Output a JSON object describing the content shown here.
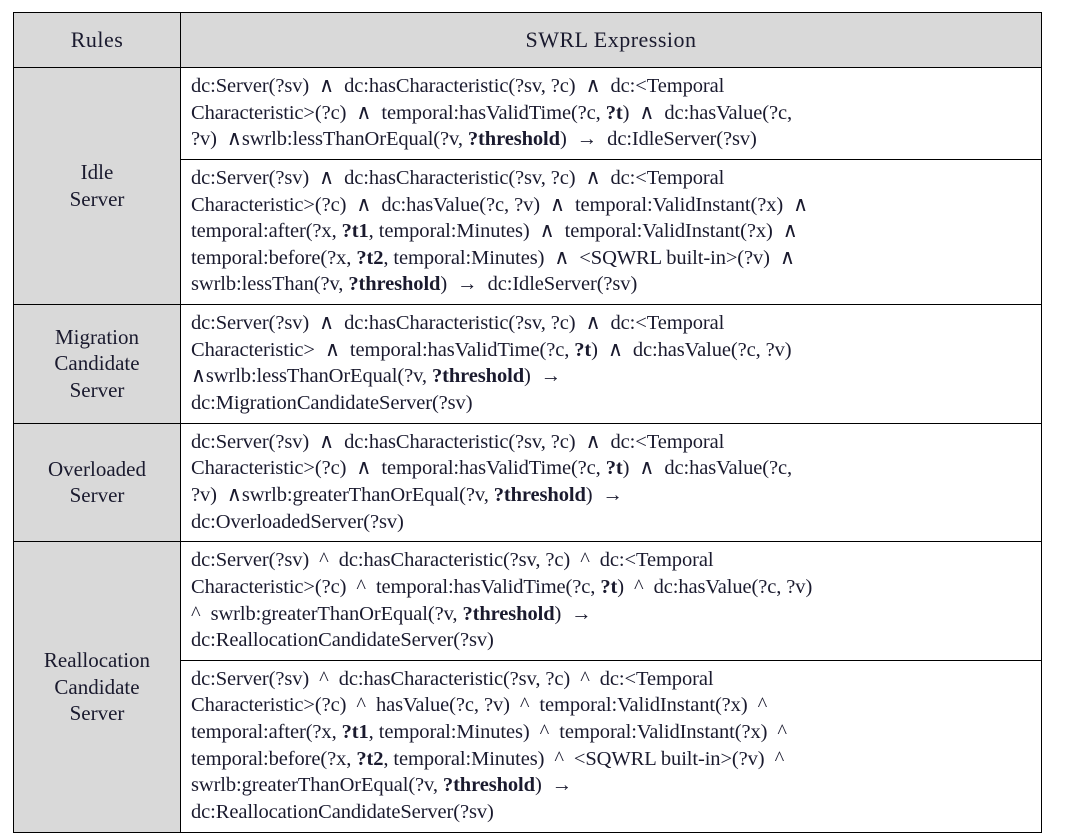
{
  "table": {
    "headers": {
      "rules": "Rules",
      "expression": "SWRL Expression"
    },
    "groups": [
      {
        "name": "Idle\nServer",
        "rows": [
          {
            "lines": [
              [
                {
                  "t": "dc:Server(?sv)  ∧  dc:hasCharacteristic(?sv, ?c)  ∧  dc:<Temporal"
                }
              ],
              [
                {
                  "t": "Characteristic>(?c)  ∧  temporal:hasValidTime(?c, "
                },
                {
                  "t": "?t",
                  "b": true
                },
                {
                  "t": ")  ∧  dc:hasValue(?c,"
                }
              ],
              [
                {
                  "t": "?v)  ∧swrlb:lessThanOrEqual(?v, "
                },
                {
                  "t": "?threshold",
                  "b": true
                },
                {
                  "t": ")  →  dc:IdleServer(?sv)"
                }
              ]
            ]
          },
          {
            "lines": [
              [
                {
                  "t": "dc:Server(?sv)  ∧  dc:hasCharacteristic(?sv, ?c)  ∧  dc:<Temporal"
                }
              ],
              [
                {
                  "t": "Characteristic>(?c)  ∧  dc:hasValue(?c, ?v)  ∧  temporal:ValidInstant(?x)  ∧"
                }
              ],
              [
                {
                  "t": "temporal:after(?x, "
                },
                {
                  "t": "?t1",
                  "b": true
                },
                {
                  "t": ", temporal:Minutes)  ∧  temporal:ValidInstant(?x)  ∧"
                }
              ],
              [
                {
                  "t": "temporal:before(?x, "
                },
                {
                  "t": "?t2",
                  "b": true
                },
                {
                  "t": ", temporal:Minutes)  ∧  <SQWRL built-in>(?v)  ∧"
                }
              ],
              [
                {
                  "t": "swrlb:lessThan(?v, "
                },
                {
                  "t": "?threshold",
                  "b": true
                },
                {
                  "t": ")  →  dc:IdleServer(?sv)"
                }
              ]
            ]
          }
        ]
      },
      {
        "name": "Migration\nCandidate\nServer",
        "rows": [
          {
            "lines": [
              [
                {
                  "t": "dc:Server(?sv)  ∧  dc:hasCharacteristic(?sv, ?c)  ∧  dc:<Temporal"
                }
              ],
              [
                {
                  "t": "Characteristic>  ∧  temporal:hasValidTime(?c, "
                },
                {
                  "t": "?t",
                  "b": true
                },
                {
                  "t": ")  ∧  dc:hasValue(?c, ?v)"
                }
              ],
              [
                {
                  "t": "∧swrlb:lessThanOrEqual(?v, "
                },
                {
                  "t": "?threshold",
                  "b": true
                },
                {
                  "t": ")  →"
                }
              ],
              [
                {
                  "t": "dc:MigrationCandidateServer(?sv)"
                }
              ]
            ]
          }
        ]
      },
      {
        "name": "Overloaded\nServer",
        "rows": [
          {
            "lines": [
              [
                {
                  "t": "dc:Server(?sv)  ∧  dc:hasCharacteristic(?sv, ?c)  ∧  dc:<Temporal"
                }
              ],
              [
                {
                  "t": "Characteristic>(?c)  ∧  temporal:hasValidTime(?c, "
                },
                {
                  "t": "?t",
                  "b": true
                },
                {
                  "t": ")  ∧  dc:hasValue(?c,"
                }
              ],
              [
                {
                  "t": "?v)  ∧swrlb:greaterThanOrEqual(?v, "
                },
                {
                  "t": "?threshold",
                  "b": true
                },
                {
                  "t": ")  →"
                }
              ],
              [
                {
                  "t": "dc:OverloadedServer(?sv)"
                }
              ]
            ]
          }
        ]
      },
      {
        "name": "Reallocation\nCandidate\nServer",
        "rows": [
          {
            "lines": [
              [
                {
                  "t": "dc:Server(?sv)  ^  dc:hasCharacteristic(?sv, ?c)  ^  dc:<Temporal"
                }
              ],
              [
                {
                  "t": "Characteristic>(?c)  ^  temporal:hasValidTime(?c, "
                },
                {
                  "t": "?t",
                  "b": true
                },
                {
                  "t": ")  ^  dc:hasValue(?c, ?v)"
                }
              ],
              [
                {
                  "t": "^  swrlb:greaterThanOrEqual(?v, "
                },
                {
                  "t": "?threshold",
                  "b": true
                },
                {
                  "t": ")  →"
                }
              ],
              [
                {
                  "t": "dc:ReallocationCandidateServer(?sv)"
                }
              ]
            ]
          },
          {
            "lines": [
              [
                {
                  "t": "dc:Server(?sv)  ^  dc:hasCharacteristic(?sv, ?c)  ^  dc:<Temporal"
                }
              ],
              [
                {
                  "t": "Characteristic>(?c)  ^  hasValue(?c, ?v)  ^  temporal:ValidInstant(?x)  ^"
                }
              ],
              [
                {
                  "t": "temporal:after(?x, "
                },
                {
                  "t": "?t1",
                  "b": true
                },
                {
                  "t": ", temporal:Minutes)  ^  temporal:ValidInstant(?x)  ^"
                }
              ],
              [
                {
                  "t": "temporal:before(?x, "
                },
                {
                  "t": "?t2",
                  "b": true
                },
                {
                  "t": ", temporal:Minutes)  ^  <SQWRL built-in>(?v)  ^"
                }
              ],
              [
                {
                  "t": "swrlb:greaterThanOrEqual(?v, "
                },
                {
                  "t": "?threshold",
                  "b": true
                },
                {
                  "t": ")  →"
                }
              ],
              [
                {
                  "t": "dc:ReallocationCandidateServer(?sv)"
                }
              ]
            ]
          }
        ]
      }
    ]
  },
  "colors": {
    "header_fill": "#d9d9d9",
    "rule_name_fill": "#d9d9d9",
    "expression_fill": "#ffffff",
    "border": "#000000",
    "text": "#1a1a2e"
  }
}
